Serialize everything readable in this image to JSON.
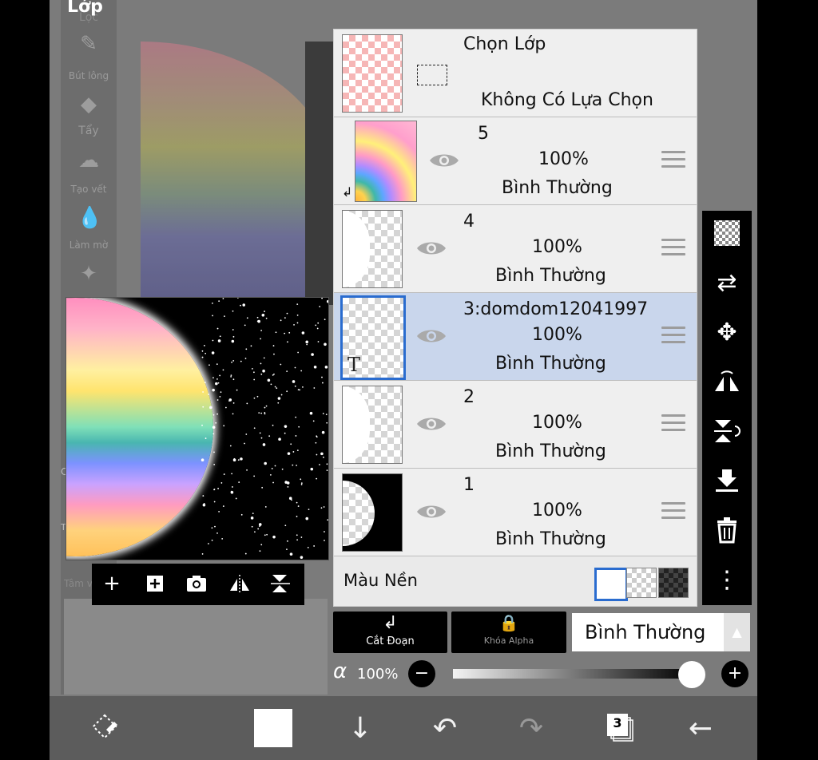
{
  "header": {
    "title": "Lớp",
    "subtitle": "Lọc"
  },
  "tools": [
    {
      "label": "Bút lông",
      "icon": "brush-icon"
    },
    {
      "label": "Tẩy",
      "icon": "eraser-icon"
    },
    {
      "label": "Tạo vết",
      "icon": "smudge-icon"
    },
    {
      "label": "Làm mờ",
      "icon": "blur-icon"
    },
    {
      "label": "",
      "icon": "magic-wand-icon"
    }
  ],
  "partial_labels": {
    "c": "C",
    "th": "Th",
    "tam": "Tâm v"
  },
  "selection_row": {
    "title": "Chọn Lớp",
    "status": "Không Có Lựa Chọn"
  },
  "layers": [
    {
      "name": "5",
      "opacity": "100%",
      "mode": "Bình Thường"
    },
    {
      "name": "4",
      "opacity": "100%",
      "mode": "Bình Thường"
    },
    {
      "name": "3:domdom12041997",
      "opacity": "100%",
      "mode": "Bình Thường",
      "selected": true,
      "text_marker": "T"
    },
    {
      "name": "2",
      "opacity": "100%",
      "mode": "Bình Thường"
    },
    {
      "name": "1",
      "opacity": "100%",
      "mode": "Bình Thường"
    }
  ],
  "background_row": {
    "label": "Màu Nền"
  },
  "buttons": {
    "clipping": "Cắt Đoạn",
    "alpha_lock": "Khóa Alpha"
  },
  "blend_mode": {
    "value": "Bình Thường"
  },
  "alpha": {
    "symbol": "α",
    "value": "100%",
    "level": 1.0
  },
  "bottombar": {
    "layer_count": "3"
  },
  "colors": {
    "selection": "#c9d6ec",
    "selected_border": "#2a6ccf",
    "panel": "#efefef"
  }
}
